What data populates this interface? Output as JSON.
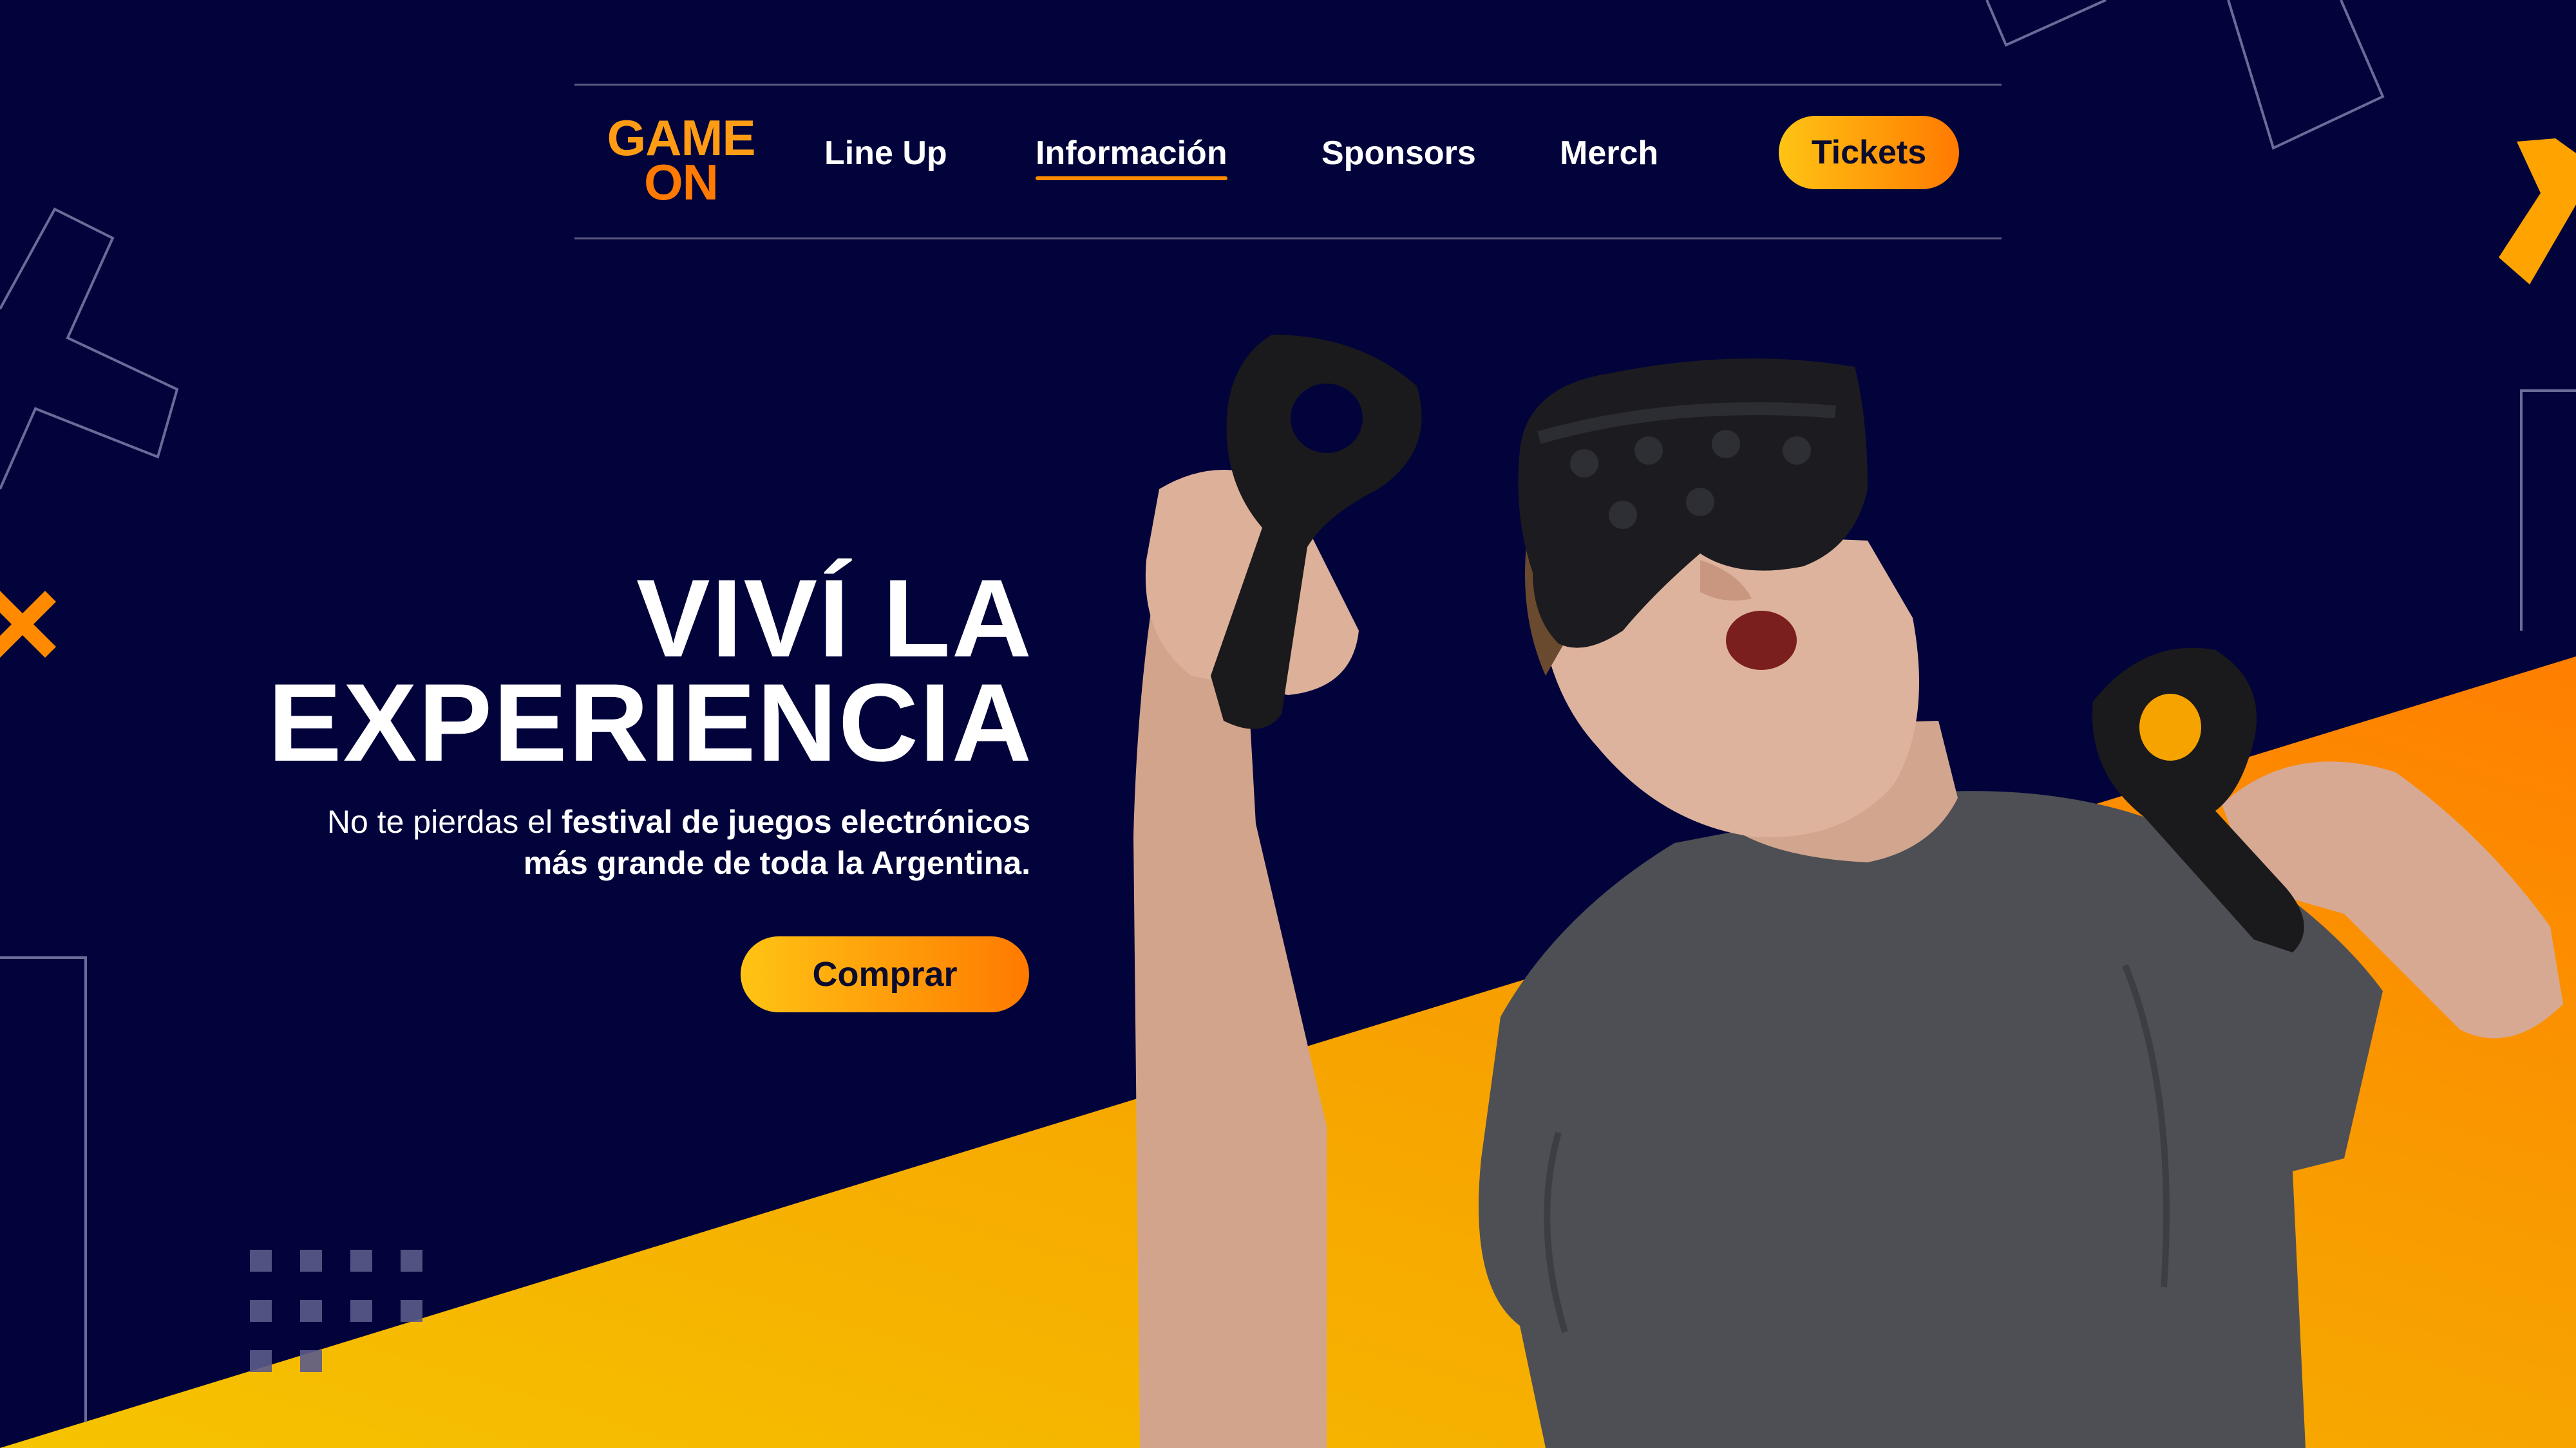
{
  "brand": {
    "line1": "GAME",
    "line2": "ON"
  },
  "nav": {
    "items": [
      {
        "label": "Line Up"
      },
      {
        "label": "Información",
        "active": true
      },
      {
        "label": "Sponsors"
      },
      {
        "label": "Merch"
      }
    ],
    "cta_label": "Tickets"
  },
  "hero": {
    "title_line1": "VIVÍ LA",
    "title_line2": "EXPERIENCIA",
    "subtitle_plain": "No te pierdas el ",
    "subtitle_bold_1": "festival de juegos electrónicos",
    "subtitle_bold_2": "más grande de toda la Argentina.",
    "button_label": "Comprar"
  },
  "colors": {
    "background": "#03033b",
    "accent_orange": "#ff7a00",
    "accent_yellow": "#ffc414",
    "text": "#ffffff"
  },
  "icons": [
    "close-x-icon",
    "chevron-right-icon"
  ]
}
